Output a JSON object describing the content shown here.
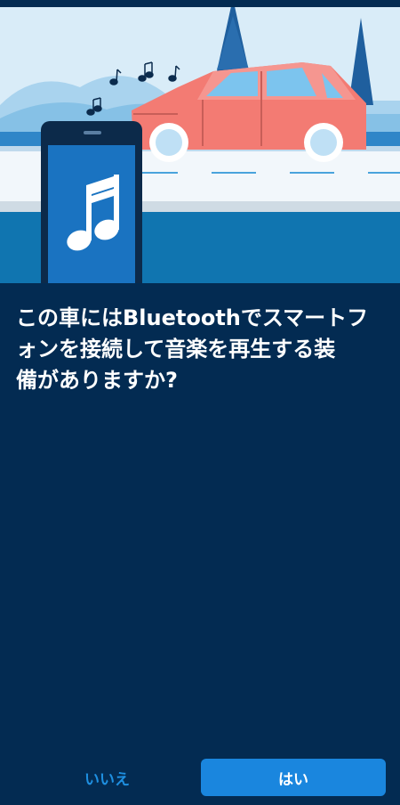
{
  "question": {
    "line1": "この車にはBluetoothでスマートフ",
    "line2": "ォンを接続して音楽を再生する装",
    "line3": "備がありますか?"
  },
  "buttons": {
    "no_label": "いいえ",
    "yes_label": "はい"
  },
  "illustration": {
    "icons": [
      "music-notes-icon",
      "car-icon",
      "phone-icon",
      "music-note-icon",
      "pine-tree-icon"
    ]
  },
  "colors": {
    "background": "#032b52",
    "accent": "#1a86de",
    "car": "#f37b73",
    "sky": "#d7eaf6"
  }
}
